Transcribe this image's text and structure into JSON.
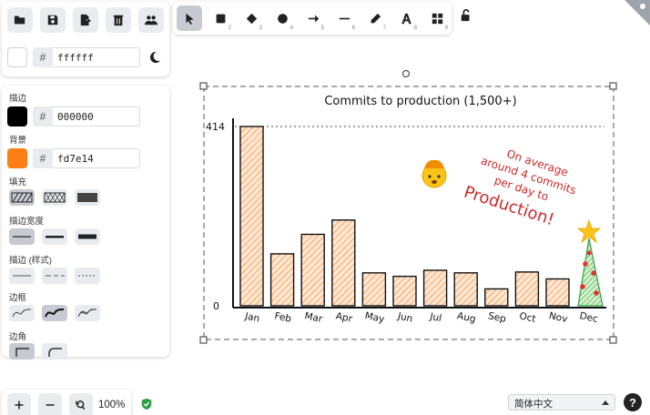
{
  "canvas_background": {
    "hex": "ffffff",
    "color": "#ffffff"
  },
  "toolbar": {
    "file_tools": [
      "open-icon",
      "save-icon",
      "export-icon",
      "delete-icon",
      "collaborate-icon"
    ],
    "shape_tools": [
      {
        "name": "selection",
        "icon": "pointer-icon",
        "shortcut": "1",
        "active": true
      },
      {
        "name": "rectangle",
        "icon": "square-icon",
        "shortcut": "2"
      },
      {
        "name": "diamond",
        "icon": "diamond-icon",
        "shortcut": "3"
      },
      {
        "name": "ellipse",
        "icon": "circle-icon",
        "shortcut": "4"
      },
      {
        "name": "arrow",
        "icon": "arrow-icon",
        "shortcut": "5"
      },
      {
        "name": "line",
        "icon": "line-icon",
        "shortcut": "6"
      },
      {
        "name": "draw",
        "icon": "pencil-icon",
        "shortcut": "7"
      },
      {
        "name": "text",
        "icon": "text-icon",
        "shortcut": "8"
      },
      {
        "name": "library",
        "icon": "grid-icon",
        "shortcut": "9"
      }
    ]
  },
  "properties": {
    "stroke_label": "描边",
    "stroke_hex": "000000",
    "stroke_color": "#000000",
    "background_label": "背景",
    "background_hex": "fd7e14",
    "background_color": "#fd7e14",
    "fill_label": "填充",
    "stroke_width_label": "描边宽度",
    "stroke_style_label": "描边 (样式)",
    "sloppiness_label": "边框",
    "edges_label": "边角"
  },
  "zoom": {
    "level": "100%"
  },
  "language": {
    "selected": "简体中文"
  },
  "help_label": "?",
  "chart_data": {
    "type": "bar",
    "title": "Commits to production (1,500+)",
    "categories": [
      "Jan",
      "Feb",
      "Mar",
      "Apr",
      "May",
      "Jun",
      "Jul",
      "Aug",
      "Sep",
      "Oct",
      "Nov",
      "Dec"
    ],
    "values": [
      414,
      120,
      165,
      198,
      76,
      68,
      82,
      76,
      39,
      78,
      62,
      110
    ],
    "ylim": [
      0,
      414
    ],
    "y_ticks": [
      "0",
      "414"
    ],
    "bar_color": "#fd7e14",
    "annotation": {
      "line1": "On average",
      "line2": "around 4 commits",
      "line3": "per day to",
      "line4": "Production!",
      "color": "#c92a2a"
    }
  }
}
